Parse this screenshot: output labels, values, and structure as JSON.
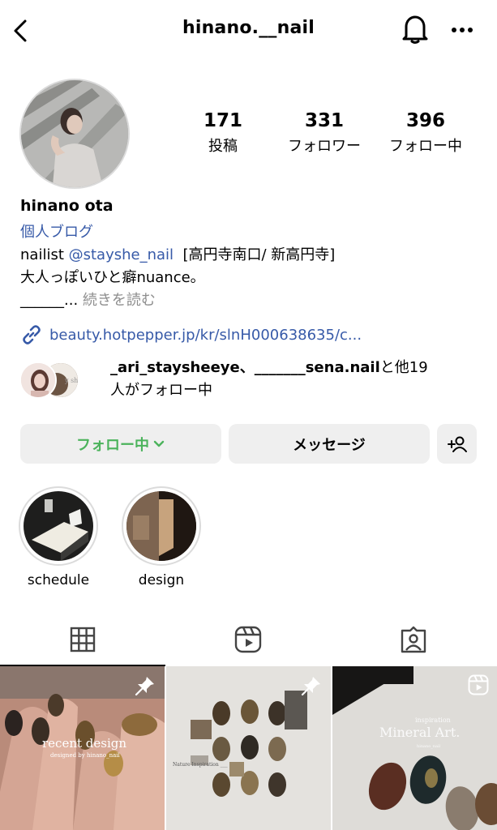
{
  "header": {
    "username": "hinano.__nail",
    "back_icon": "chevron-left-icon",
    "bell_icon": "bell-icon",
    "more_icon": "more-horizontal-icon"
  },
  "stats": [
    {
      "value": "171",
      "label": "投稿"
    },
    {
      "value": "331",
      "label": "フォロワー"
    },
    {
      "value": "396",
      "label": "フォロー中"
    }
  ],
  "bio": {
    "name": "hinano ota",
    "category": "個人ブログ",
    "line1_prefix": "nailist ",
    "line1_mention": "@stayshe_nail",
    "line1_suffix": "[高円寺南口/ 新高円寺]",
    "line2": "大人っぽいひと癖nuance。",
    "line3_prefix": "______... ",
    "line3_more": "続きを読む",
    "link": "beauty.hotpepper.jp/kr/slnH000638635/c..."
  },
  "followed_by": {
    "names": "_ari_staysheeye、_______sena.nail",
    "suffix": "と他19",
    "line2": "人がフォロー中"
  },
  "actions": {
    "following_label": "フォロー中",
    "message_label": "メッセージ"
  },
  "highlights": [
    {
      "label": "schedule"
    },
    {
      "label": "design"
    }
  ],
  "tabs": [
    "grid-icon",
    "reels-icon",
    "tagged-icon"
  ],
  "posts": [
    {
      "caption_title": "recent design",
      "caption_sub": "designed by hinano_nail",
      "pinned": true
    },
    {
      "caption_title": "Nature Inspiration ___",
      "pinned": true
    },
    {
      "caption_small": "inspiration",
      "caption_title": "Mineral Art.",
      "caption_sub": "hinano_nail",
      "reel": true
    }
  ],
  "colors": {
    "link_blue": "#375aa8",
    "following_green": "#4cb35c",
    "button_bg": "#efefef"
  }
}
